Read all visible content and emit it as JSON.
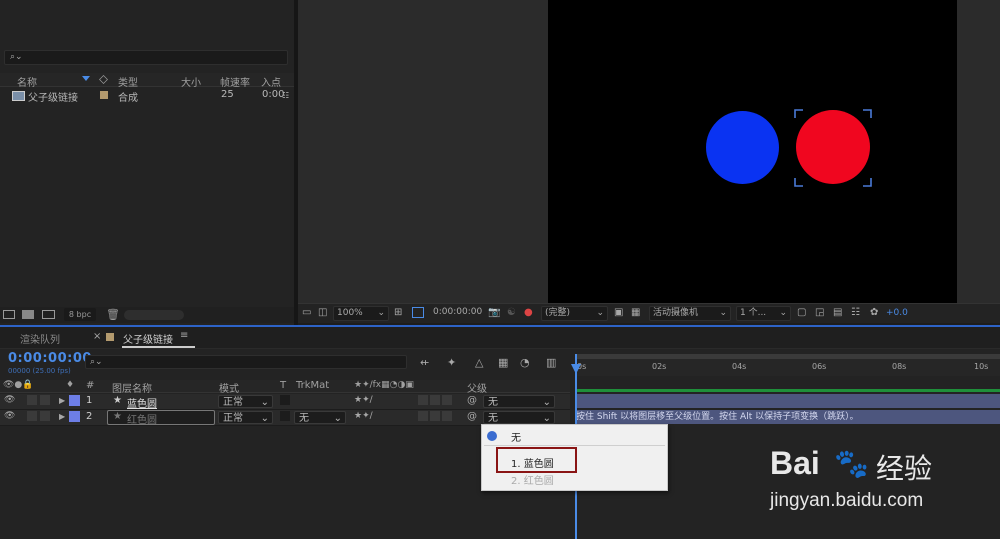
{
  "project": {
    "search_placeholder": "⌕⌄",
    "columns": {
      "name": "名称",
      "type": "类型",
      "size": "大小",
      "framerate": "帧速率",
      "in": "入点"
    },
    "item": {
      "name": "父子级链接",
      "type": "合成",
      "framerate": "25",
      "in": "0:00"
    },
    "bpc": "8 bpc"
  },
  "viewer": {
    "zoom": "100%",
    "timecode": "0:00:00:00",
    "resolution": "(完整)",
    "camera": "活动摄像机",
    "views": "1 个...",
    "exposure": "+0.0",
    "colors": {
      "blue_circle": "#0a33f2",
      "red_circle": "#f0061f",
      "bracket": "#4a7ad8"
    }
  },
  "tabs": {
    "render_queue": "渲染队列",
    "close": "×",
    "comp": "父子级链接",
    "menu": "≡"
  },
  "timeline": {
    "time": "0:00:00:00",
    "fps": "00000 (25.00 fps)",
    "search_placeholder": "⌕⌄",
    "headers": {
      "num": "#",
      "layer_name": "图层名称",
      "mode": "模式",
      "t": "T",
      "trkmat": "TrkMat",
      "parent": "父级"
    },
    "layers": [
      {
        "index": "1",
        "name": "蓝色圆",
        "mode": "正常",
        "trkmat": "",
        "parent": "无"
      },
      {
        "index": "2",
        "name": "红色圆",
        "mode": "正常",
        "trkmat": "无",
        "parent": "无"
      }
    ],
    "ruler": [
      "0s",
      "02s",
      "04s",
      "06s",
      "08s",
      "10s"
    ],
    "hint": "按住 Shift 以将图层移至父级位置。按住 Alt 以保持子项变换（跳跃）。"
  },
  "dropdown": {
    "none": "无",
    "opt1": "1. 蓝色圆",
    "opt2": "2. 红色圆"
  },
  "watermark": {
    "brand": "Bai",
    "brand2": "经验",
    "url": "jingyan.baidu.com"
  }
}
